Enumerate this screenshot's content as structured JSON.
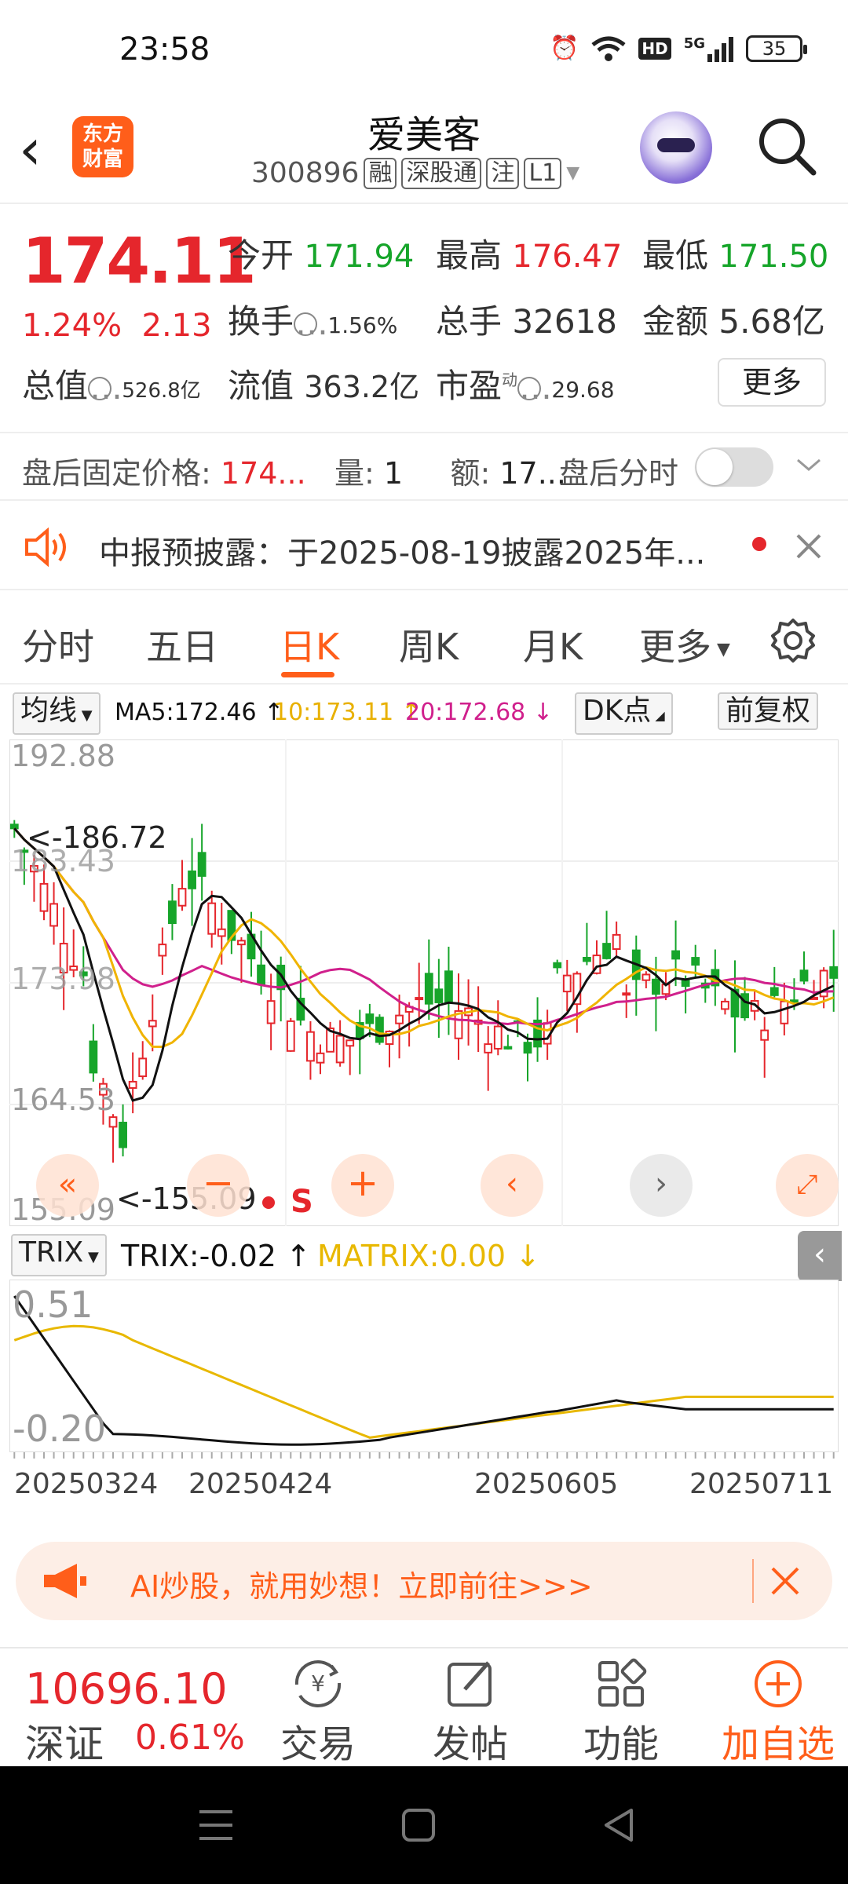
{
  "status_bar": {
    "time": "23:58",
    "hd": "HD",
    "net": "5G",
    "battery": "35"
  },
  "header": {
    "logo_line1": "东方",
    "logo_line2": "财富",
    "stock_name": "爱美客",
    "stock_code": "300896",
    "tags": [
      "融",
      "深股通",
      "注",
      "L1"
    ]
  },
  "quote": {
    "price": "174.11",
    "change_pct": "1.24%",
    "change_amt": "2.13",
    "open_label": "今开",
    "open": "171.94",
    "high_label": "最高",
    "high": "176.47",
    "low_label": "最低",
    "low": "171.50",
    "turnover_label": "换手",
    "turnover": "1.56%",
    "volume_label": "总手",
    "volume": "32618",
    "amount_label": "金额",
    "amount": "5.68亿",
    "mktcap_label": "总值",
    "mktcap": "526.8亿",
    "float_label": "流值",
    "float_cap": "363.2亿",
    "pe_label": "市盈",
    "pe_sup": "动",
    "pe": "29.68",
    "more": "更多"
  },
  "after_hours": {
    "label": "盘后固定价格:",
    "price": "174...",
    "vol_label": "量:",
    "vol": "1",
    "amt_label": "额:",
    "amt": "17...",
    "timeshare": "盘后分时"
  },
  "notice": {
    "text": "中报预披露：于2025-08-19披露2025年..."
  },
  "tabs": [
    "分时",
    "五日",
    "日K",
    "周K",
    "月K",
    "更多"
  ],
  "active_tab": "日K",
  "ma_legend": {
    "selector": "均线",
    "ma5": "MA5:172.46",
    "ma10": "10:173.11",
    "ma20": "20:172.68",
    "dk": "DK点",
    "fq": "前复权"
  },
  "colors": {
    "accent": "#ff5e1a",
    "up": "#e5262c",
    "down": "#16a52a",
    "ma5": "#111111",
    "ma10": "#f0b400",
    "ma20": "#d0208c",
    "matrix": "#e8b800"
  },
  "kline": {
    "y_labels": [
      "192.88",
      "183.43",
      "173.98",
      "164.53",
      "155.09"
    ],
    "max_marker": "<-186.72",
    "min_marker": "<-155.09",
    "signal": "S"
  },
  "trix": {
    "selector": "TRIX",
    "trix": "TRIX:-0.02",
    "matrix": "MATRIX:0.00",
    "y_top": "0.51",
    "y_bottom": "-0.20"
  },
  "dates": [
    "20250324",
    "20250424",
    "20250605",
    "20250711"
  ],
  "ad": {
    "text": "AI炒股，就用妙想！立即前往>>>"
  },
  "bottom_bar": {
    "index_value": "10696.10",
    "index_name": "深证",
    "index_change": "0.61%",
    "trade": "交易",
    "post": "发帖",
    "functions": "功能",
    "add_watch": "加自选"
  }
}
